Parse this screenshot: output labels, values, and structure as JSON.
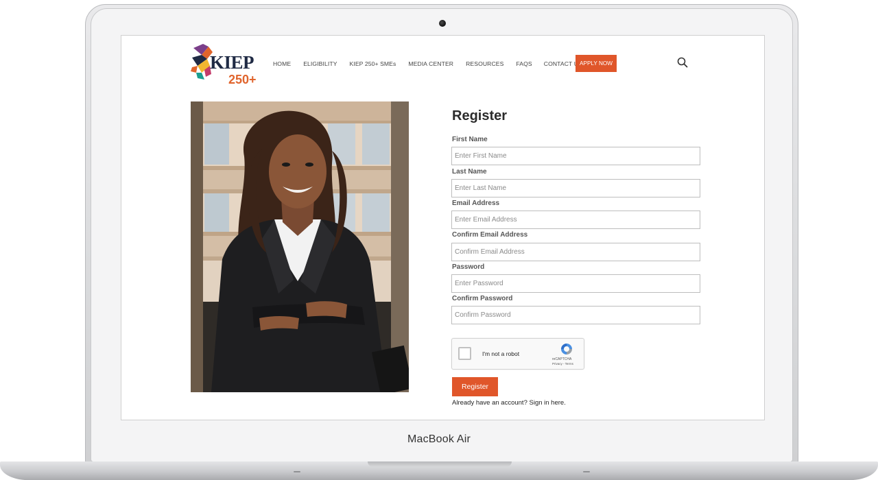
{
  "device": {
    "brand": "MacBook Air"
  },
  "header": {
    "logo": {
      "word": "KIEP",
      "number": "250+"
    },
    "nav": [
      "HOME",
      "ELIGIBILITY",
      "KIEP 250+ SMEs",
      "MEDIA CENTER",
      "RESOURCES",
      "FAQS",
      "CONTACT US"
    ],
    "apply_label": "APPLY NOW",
    "accent": "#e0562a"
  },
  "form": {
    "title": "Register",
    "fields": [
      {
        "label": "First Name",
        "placeholder": "Enter First Name"
      },
      {
        "label": "Last Name",
        "placeholder": "Enter Last Name"
      },
      {
        "label": "Email Address",
        "placeholder": "Enter Email Address"
      },
      {
        "label": "Confirm Email Address",
        "placeholder": "Confirm Email Address"
      },
      {
        "label": "Password",
        "placeholder": "Enter Password"
      },
      {
        "label": "Confirm Password",
        "placeholder": "Confirm Password"
      }
    ],
    "captcha": {
      "label": "I'm not a robot",
      "brand": "reCAPTCHA",
      "terms": "Privacy - Terms"
    },
    "submit_label": "Register",
    "signin_text": "Already have an account? Sign in here."
  },
  "icons": {
    "search": "search-icon",
    "captcha": "recaptcha-icon"
  }
}
